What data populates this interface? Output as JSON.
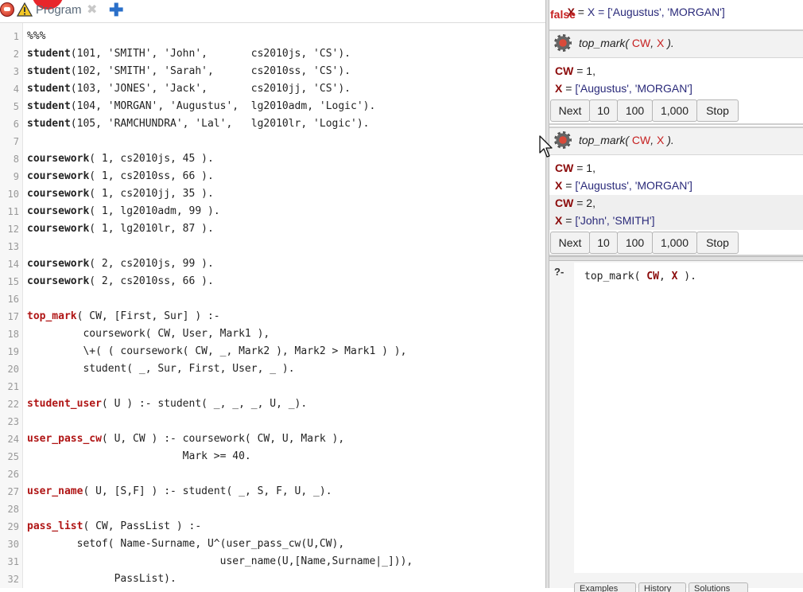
{
  "tab": {
    "title": "Program",
    "close_glyph": "✖",
    "add_glyph": "✚",
    "logo": "swish-logo",
    "warning_icon": "warning-icon"
  },
  "editor": {
    "lines": [
      {
        "n": "1",
        "code": "%%%"
      },
      {
        "n": "2",
        "code": "student(101, 'SMITH', 'John',       cs2010js, 'CS')."
      },
      {
        "n": "3",
        "code": "student(102, 'SMITH', 'Sarah',      cs2010ss, 'CS')."
      },
      {
        "n": "4",
        "code": "student(103, 'JONES', 'Jack',       cs2010jj, 'CS')."
      },
      {
        "n": "5",
        "code": "student(104, 'MORGAN', 'Augustus',  lg2010adm, 'Logic')."
      },
      {
        "n": "6",
        "code": "student(105, 'RAMCHUNDRA', 'Lal',   lg2010lr, 'Logic')."
      },
      {
        "n": "7",
        "code": ""
      },
      {
        "n": "8",
        "code": "coursework( 1, cs2010js, 45 )."
      },
      {
        "n": "9",
        "code": "coursework( 1, cs2010ss, 66 )."
      },
      {
        "n": "10",
        "code": "coursework( 1, cs2010jj, 35 )."
      },
      {
        "n": "11",
        "code": "coursework( 1, lg2010adm, 99 )."
      },
      {
        "n": "12",
        "code": "coursework( 1, lg2010lr, 87 )."
      },
      {
        "n": "13",
        "code": ""
      },
      {
        "n": "14",
        "code": "coursework( 2, cs2010js, 99 )."
      },
      {
        "n": "15",
        "code": "coursework( 2, cs2010ss, 66 )."
      },
      {
        "n": "16",
        "code": ""
      },
      {
        "n": "17",
        "code": "top_mark( CW, [First, Sur] ) :-"
      },
      {
        "n": "18",
        "code": "         coursework( CW, User, Mark1 ),"
      },
      {
        "n": "19",
        "code": "         \\+( ( coursework( CW, _, Mark2 ), Mark2 > Mark1 ) ),"
      },
      {
        "n": "20",
        "code": "         student( _, Sur, First, User, _ )."
      },
      {
        "n": "21",
        "code": ""
      },
      {
        "n": "22",
        "code": "student_user( U ) :- student( _, _, _, U, _)."
      },
      {
        "n": "23",
        "code": ""
      },
      {
        "n": "24",
        "code": "user_pass_cw( U, CW ) :- coursework( CW, U, Mark ),"
      },
      {
        "n": "25",
        "code": "                         Mark >= 40."
      },
      {
        "n": "26",
        "code": ""
      },
      {
        "n": "27",
        "code": "user_name( U, [S,F] ) :- student( _, S, F, U, _)."
      },
      {
        "n": "28",
        "code": ""
      },
      {
        "n": "29",
        "code": "pass_list( CW, PassList ) :-"
      },
      {
        "n": "30",
        "code": "        setof( Name-Surname, U^(user_pass_cw(U,CW),"
      },
      {
        "n": "31",
        "code": "                               user_name(U,[Name,Surname|_])),"
      },
      {
        "n": "32",
        "code": "              PassList)."
      }
    ]
  },
  "runner": {
    "prev_answer": "X = ['Augustus', 'MORGAN']",
    "prev_false": "false",
    "box1": {
      "query_pred": "top_mark(",
      "query_args": [
        " CW",
        ",",
        " X",
        " )."
      ],
      "answers": [
        {
          "var": "CW",
          "eq": " = 1,",
          "value": ""
        },
        {
          "var": "X",
          "eq": " = ",
          "value": "['Augustus', 'MORGAN']"
        }
      ],
      "buttons": [
        "Next",
        "10",
        "100",
        "1,000",
        "Stop"
      ]
    },
    "box2": {
      "query_pred": "top_mark(",
      "query_args": [
        " CW",
        ",",
        " X",
        " )."
      ],
      "answers": [
        {
          "var": "CW",
          "eq": " = 1,",
          "value": ""
        },
        {
          "var": "X",
          "eq": " = ",
          "value": "['Augustus', 'MORGAN']"
        },
        {
          "var": "CW",
          "eq": " = 2,",
          "value": ""
        },
        {
          "var": "X",
          "eq": " = ",
          "value": "['John', 'SMITH']"
        }
      ],
      "buttons": [
        "Next",
        "10",
        "100",
        "1,000",
        "Stop"
      ]
    }
  },
  "query": {
    "prompt": "?-",
    "text_pred": "top_mark( ",
    "text_v1": "CW",
    "text_mid": ", ",
    "text_v2": "X",
    "text_end": " ).",
    "bottom_tabs": [
      "Examples",
      "History",
      "Solutions"
    ]
  },
  "colors": {
    "accent_blue": "#2a6fc9",
    "variable_red": "#8b0a0a",
    "false_red": "#c62020"
  }
}
